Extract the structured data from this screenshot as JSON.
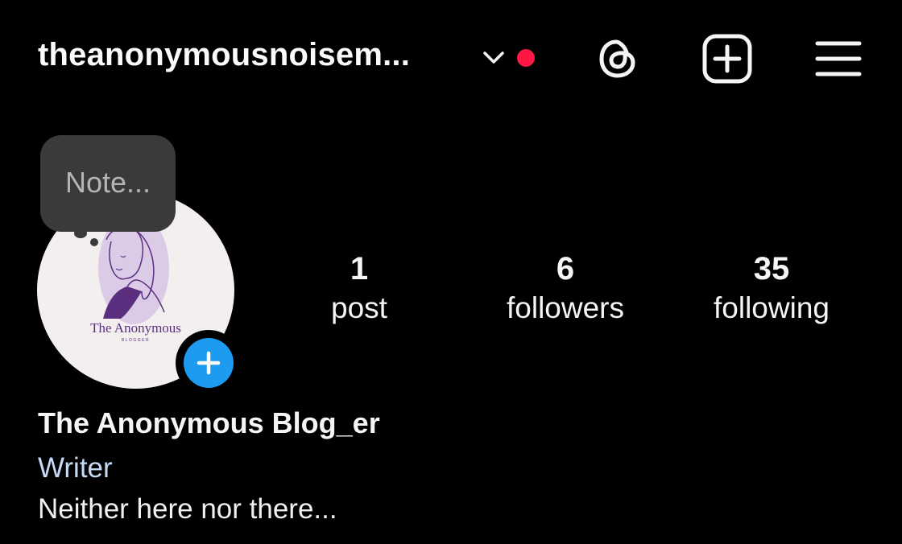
{
  "header": {
    "username": "theanonymousnoisem...",
    "chevron_icon": "chevron-down-icon",
    "notification_dot_color": "#ff1744",
    "threads_icon": "threads-icon",
    "create_icon": "plus-square-icon",
    "menu_icon": "hamburger-menu-icon"
  },
  "note": {
    "placeholder": "Note..."
  },
  "avatar": {
    "brand_text": "The Anonymous",
    "brand_subtext": "BLOGGER",
    "add_story_icon": "plus-icon",
    "add_story_color": "#1d9bf0"
  },
  "stats": {
    "posts": {
      "value": "1",
      "label": "post"
    },
    "followers": {
      "value": "6",
      "label": "followers"
    },
    "following": {
      "value": "35",
      "label": "following"
    }
  },
  "bio": {
    "display_name": "The Anonymous Blog_er",
    "category": "Writer",
    "category_color": "#c5daf3",
    "text": "Neither here nor there..."
  }
}
